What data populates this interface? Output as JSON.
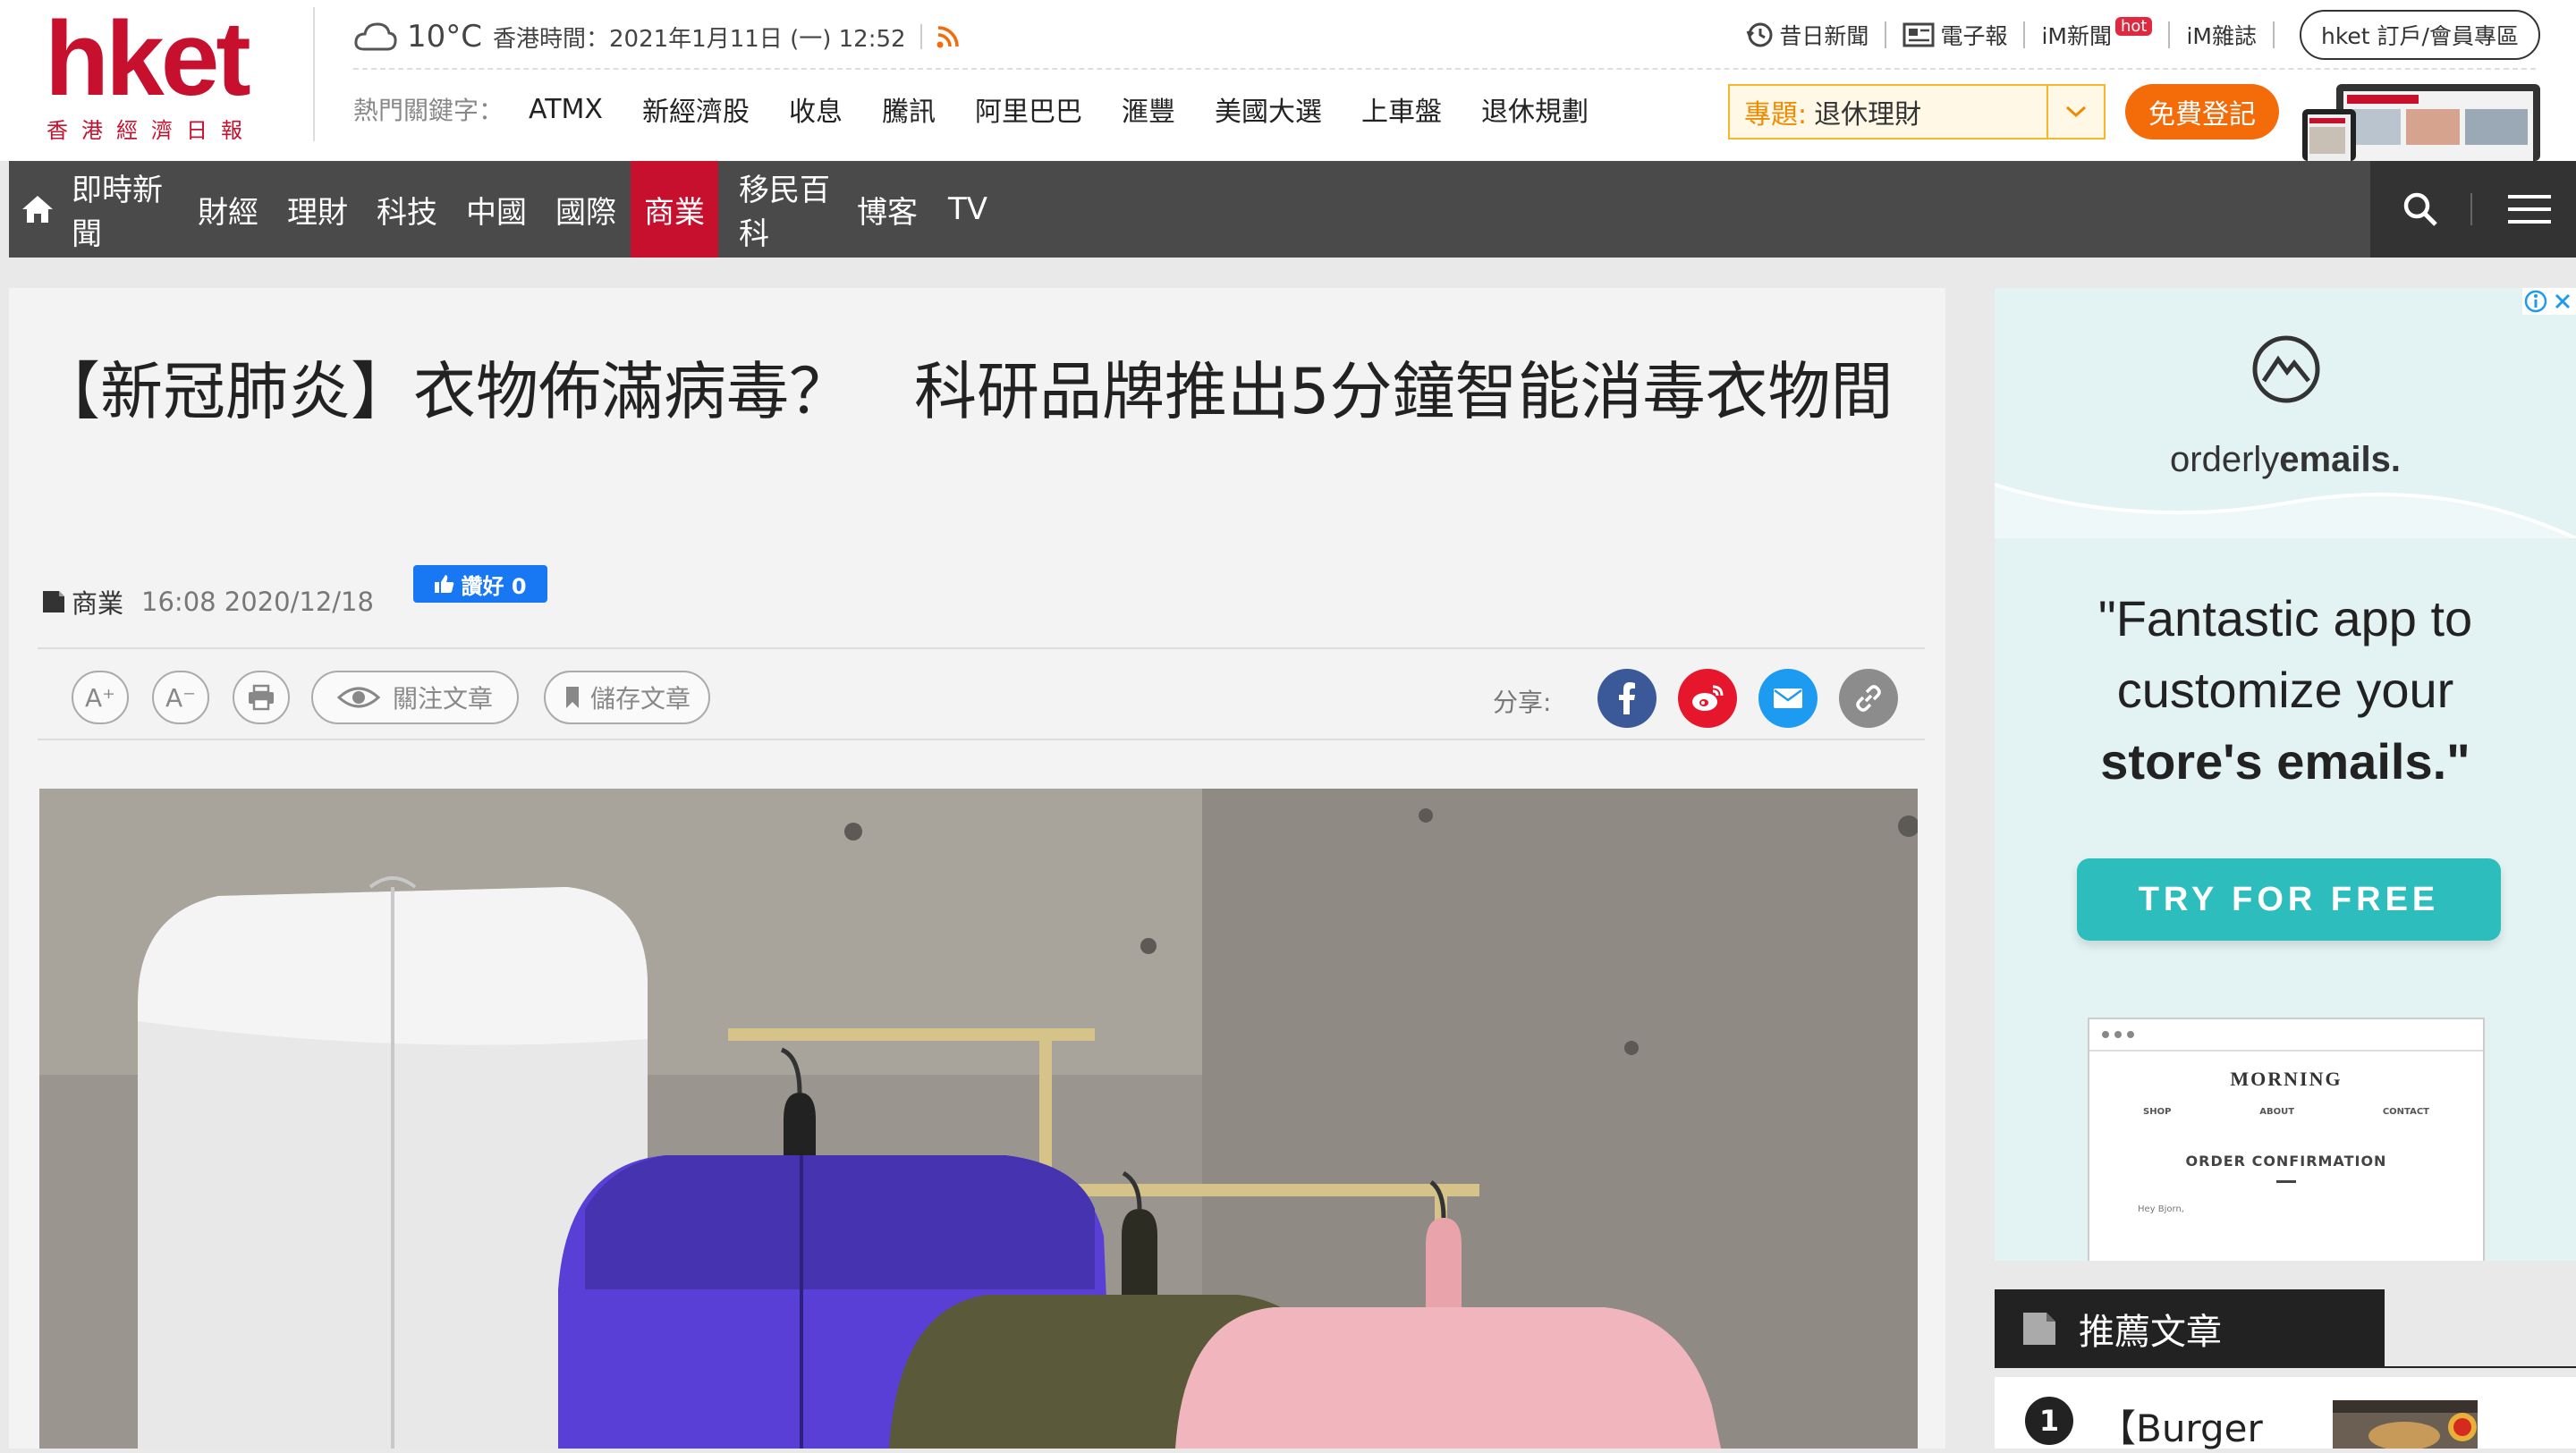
{
  "header": {
    "logo_text": "hket",
    "logo_subtext": "香港經濟日報",
    "weather": {
      "temp": "10°C",
      "datetime": "香港時間：2021年1月11日 (一) 12:52"
    },
    "top_links": [
      "昔日新聞",
      "電子報",
      "iM新聞",
      "iM雜誌"
    ],
    "hot_badge": "hot",
    "member_button": "hket 訂戶/會員專區",
    "hot_keywords_label": "熱門關鍵字：",
    "hot_keywords": [
      "ATMX",
      "新經濟股",
      "收息",
      "騰訊",
      "阿里巴巴",
      "滙豐",
      "美國大選",
      "上車盤",
      "退休規劃"
    ],
    "topic_prefix": "專題:",
    "topic_value": "退休理財",
    "signup_button": "免費登記"
  },
  "nav": {
    "items": [
      "即時新聞",
      "財經",
      "理財",
      "科技",
      "中國",
      "國際",
      "商業",
      "移民百科",
      "博客",
      "TV"
    ],
    "active": "商業"
  },
  "article": {
    "title": "【新冠肺炎】衣物佈滿病毒？　科研品牌推出5分鐘智能消毒衣物間",
    "category": "商業",
    "datetime": "16:08 2020/12/18",
    "like_label": "讚好 0",
    "toolbar": {
      "font_up": "A⁺",
      "font_down": "A⁻",
      "follow": "關注文章",
      "save": "儲存文章",
      "share_label": "分享:"
    }
  },
  "ad": {
    "brand": "orderly",
    "brand_bold": "emails.",
    "quote_line1": "\"Fantastic app to",
    "quote_line2": "customize your",
    "quote_line3": "store's emails.\"",
    "cta": "TRY FOR FREE",
    "mock_title": "MORNING",
    "mock_nav": [
      "SHOP",
      "ABOUT",
      "CONTACT"
    ],
    "mock_heading": "ORDER CONFIRMATION",
    "mock_greeting": "Hey Bjorn,"
  },
  "recommended": {
    "heading": "推薦文章",
    "item_number": "1",
    "item_text": "【Burger"
  },
  "colors": {
    "brand_red": "#c7102e",
    "nav_bg": "#4a4a4a",
    "signup_orange": "#f46b0a",
    "facebook": "#3b5998",
    "weibo": "#e6162d",
    "email": "#1d9bf0",
    "ad_teal": "#2dbdbc"
  }
}
